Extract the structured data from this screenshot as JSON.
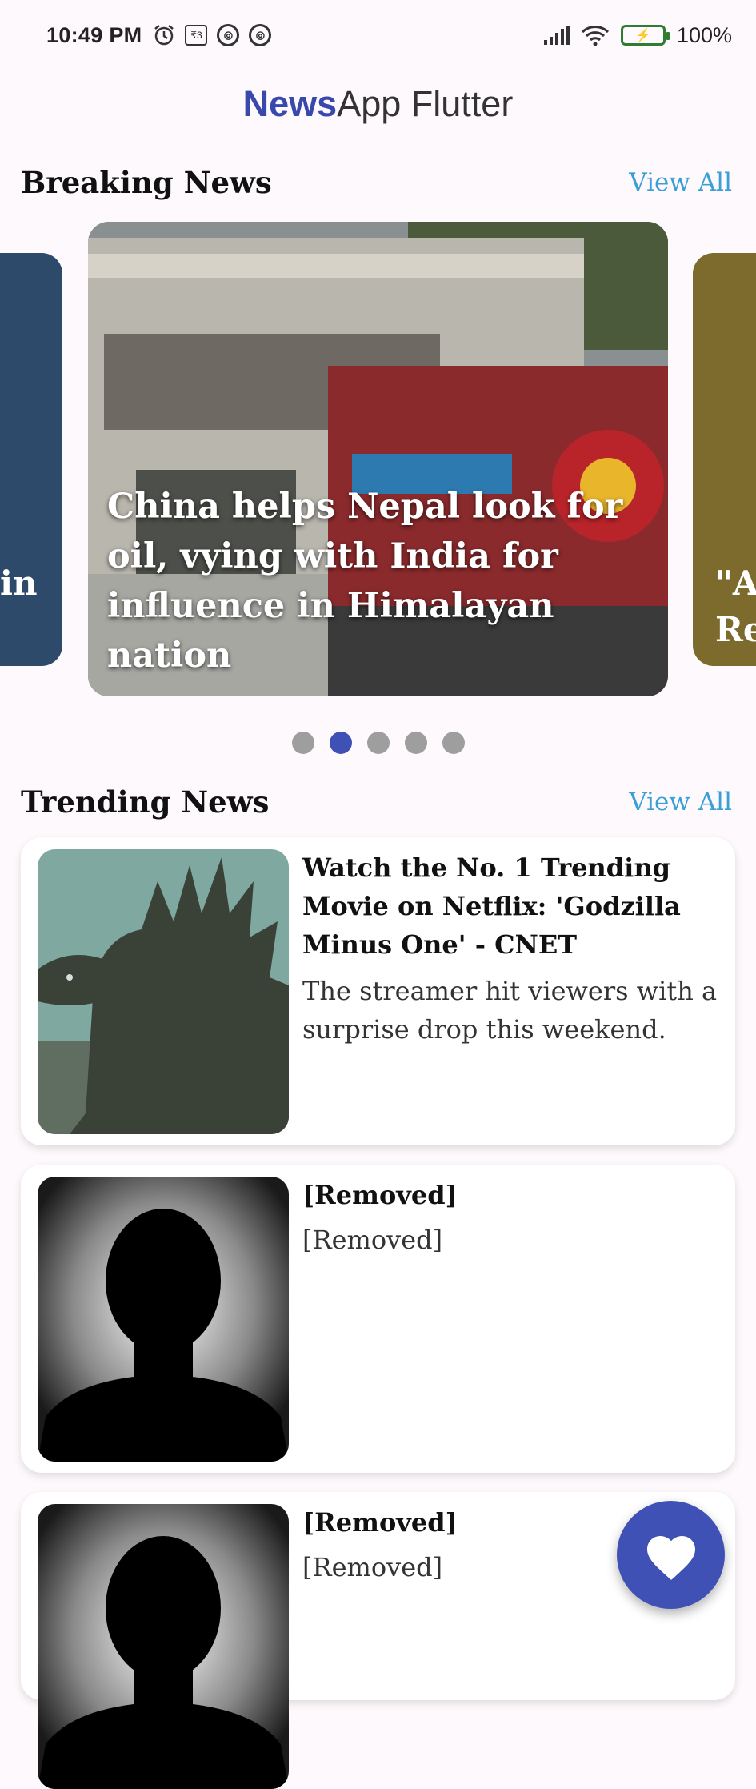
{
  "status_bar": {
    "time": "10:49 PM",
    "battery": "100%",
    "icons": [
      "alarm-icon",
      "rupee-icon",
      "app-icon",
      "app-icon",
      "signal-icon",
      "wifi-icon",
      "battery-icon"
    ]
  },
  "app_bar": {
    "brand": "News",
    "rest": "App Flutter"
  },
  "breaking": {
    "title": "Breaking News",
    "view_all": "View All",
    "main_headline": "China helps Nepal look for oil, vying with India for influence in Himalayan nation",
    "left_peek": "in",
    "right_peek_1": "\"A",
    "right_peek_2": "Re",
    "pagination": {
      "count": 5,
      "active": 2
    }
  },
  "trending": {
    "title": "Trending News",
    "view_all": "View All",
    "items": [
      {
        "title": "Watch the No. 1 Trending Movie on Netflix: 'Godzilla Minus One' - CNET",
        "desc": "The streamer hit viewers with a surprise drop this weekend."
      },
      {
        "title": "[Removed]",
        "desc": "[Removed]"
      },
      {
        "title": "[Removed]",
        "desc": "[Removed]"
      }
    ]
  },
  "fab": {
    "icon": "heart-icon"
  },
  "colors": {
    "accent": "#3f51b5",
    "link": "#3a9fd6",
    "background": "#fdf9fc"
  }
}
